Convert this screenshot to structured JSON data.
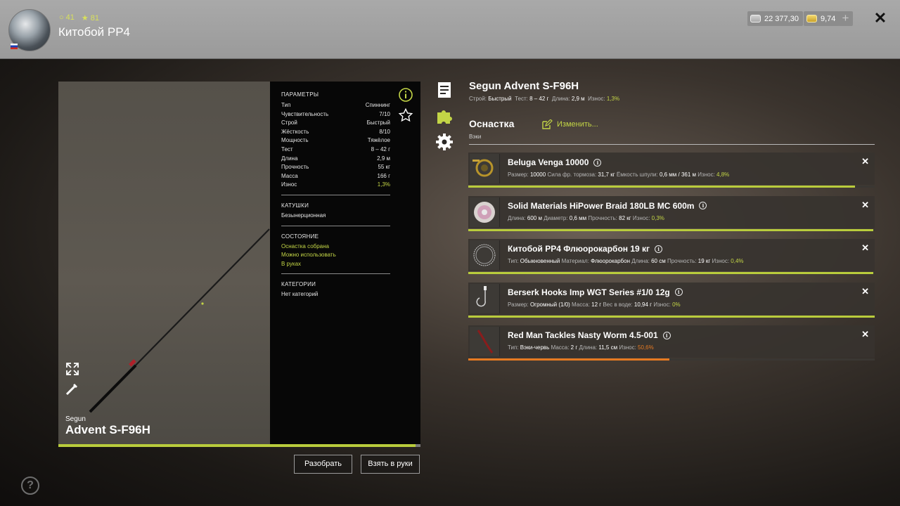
{
  "header": {
    "player_level": "41",
    "player_rank": "81",
    "player_name": "Китобой PP4",
    "silver": "22 377,30",
    "gold": "9,74",
    "plus": "+",
    "close": "✕"
  },
  "rod": {
    "brand": "Segun",
    "model": "Advent S-F96H",
    "title": "Segun Advent S-F96H",
    "sub": {
      "action_label": "Строй:",
      "action_value": "Быстрый",
      "test_label": "Тест:",
      "test_value": "8 – 42 г",
      "length_label": "Длина:",
      "length_value": "2,9 м",
      "wear_label": "Износ:",
      "wear_value": "1,3%"
    },
    "condition_progress": 0.987
  },
  "params": {
    "title": "ПАРАМЕТРЫ",
    "rows": [
      {
        "label": "Тип",
        "value": "Спиннинг"
      },
      {
        "label": "Чувствительность",
        "value": "7/10"
      },
      {
        "label": "Строй",
        "value": "Быстрый"
      },
      {
        "label": "Жёсткость",
        "value": "8/10"
      },
      {
        "label": "Мощность",
        "value": "Тяжёлое"
      },
      {
        "label": "Тест",
        "value": "8 – 42 г"
      },
      {
        "label": "Длина",
        "value": "2,9 м"
      },
      {
        "label": "Прочность",
        "value": "55 кг"
      },
      {
        "label": "Масса",
        "value": "166 г"
      },
      {
        "label": "Износ",
        "value": "1,3%"
      }
    ],
    "reels_title": "КАТУШКИ",
    "reels_value": "Безынерционная",
    "state_title": "СОСТОЯНИЕ",
    "state_lines": [
      "Оснастка собрана",
      "Можно использовать",
      "В руках"
    ],
    "cat_title": "КАТЕГОРИИ",
    "cat_value": "Нет категорий"
  },
  "buttons": {
    "disassemble": "Разобрать",
    "take": "Взять в руки"
  },
  "tackle": {
    "title": "Оснастка",
    "edit": "Изменить...",
    "subtitle": "Вэки",
    "items": [
      {
        "name": "Beluga Venga 10000",
        "fields": [
          {
            "label": "Размер:",
            "value": "10000"
          },
          {
            "label": "Сила фр. тормоза:",
            "value": "31,7 кг"
          },
          {
            "label": "Ёмкость шпули:",
            "value": "0,6 мм / 361 м"
          },
          {
            "label": "Износ:",
            "value": "4,8%"
          }
        ],
        "condition": 0.952,
        "bar_color": "#b9cc3c"
      },
      {
        "name": "Solid Materials HiPower Braid 180LB MC 600m",
        "fields": [
          {
            "label": "Длина:",
            "value": "600 м"
          },
          {
            "label": "Диаметр:",
            "value": "0,6 мм"
          },
          {
            "label": "Прочность:",
            "value": "82 кг"
          },
          {
            "label": "Износ:",
            "value": "0,3%"
          }
        ],
        "condition": 0.997,
        "bar_color": "#b9cc3c"
      },
      {
        "name": "Китобой PP4 Флюорокарбон 19 кг",
        "fields": [
          {
            "label": "Тип:",
            "value": "Обыкновенный"
          },
          {
            "label": "Материал:",
            "value": "Флюорокарбон"
          },
          {
            "label": "Длина:",
            "value": "60 см"
          },
          {
            "label": "Прочность:",
            "value": "19 кг"
          },
          {
            "label": "Износ:",
            "value": "0,4%"
          }
        ],
        "condition": 0.996,
        "bar_color": "#b9cc3c"
      },
      {
        "name": "Berserk Hooks Imp WGT Series #1/0 12g",
        "fields": [
          {
            "label": "Размер:",
            "value": "Огромный (1/0)"
          },
          {
            "label": "Масса:",
            "value": "12 г"
          },
          {
            "label": "Вес в воде:",
            "value": "10,94 г"
          },
          {
            "label": "Износ:",
            "value": "0%"
          }
        ],
        "condition": 1.0,
        "bar_color": "#b9cc3c"
      },
      {
        "name": "Red Man Tackles Nasty Worm 4.5-001",
        "fields": [
          {
            "label": "Тип:",
            "value": "Вэки-червь"
          },
          {
            "label": "Масса:",
            "value": "2 г"
          },
          {
            "label": "Длина:",
            "value": "11,5 см"
          },
          {
            "label": "Износ:",
            "value": "50,6%"
          }
        ],
        "condition": 0.494,
        "bar_color": "#e67a22",
        "wear_color": "orange"
      }
    ],
    "remove": "✕"
  },
  "colors": {
    "accent": "#b9cc3c",
    "warn": "#e67a22"
  }
}
